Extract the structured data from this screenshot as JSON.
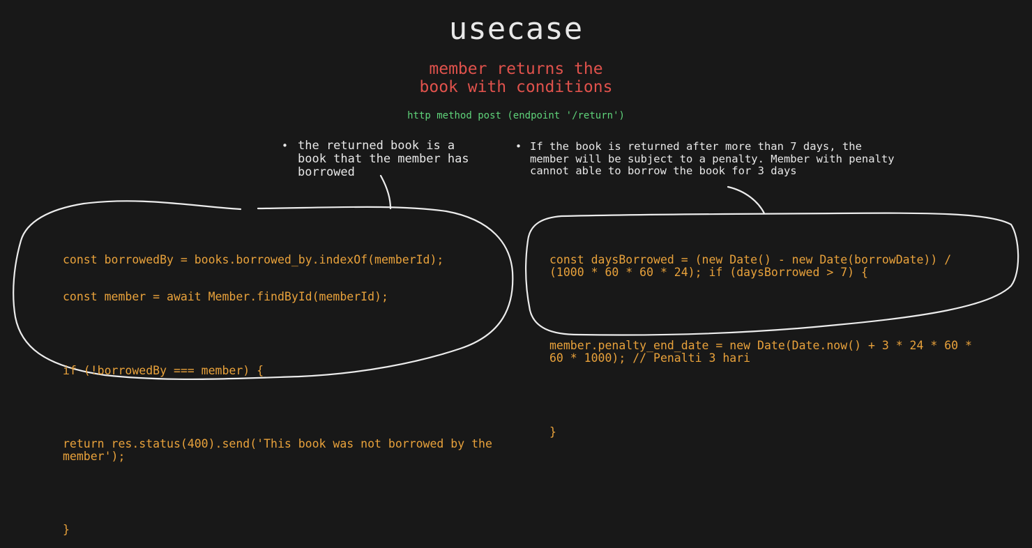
{
  "colors": {
    "background": "#181818",
    "text": "#e8e8e8",
    "heading_red": "#e0524c",
    "endpoint_green": "#5fd37a",
    "code_orange": "#e9a23b",
    "outline": "#ececec"
  },
  "title": "usecase",
  "subtitle": "member returns the\nbook with conditions",
  "endpoint": "http method post (endpoint '/return')",
  "notes": {
    "left": {
      "bullet": "•",
      "text": "the returned book is a\nbook that the member has\nborrowed"
    },
    "right": {
      "bullet": "•",
      "text": "If the book is returned after more than 7 days, the\nmember will be subject to a penalty. Member with penalty\ncannot able to borrow the book for 3 days"
    }
  },
  "code_blocks": {
    "left": {
      "line1": "const borrowedBy = books.borrowed_by.indexOf(memberId);",
      "line2": "const member = await Member.findById(memberId);",
      "line3": "if (!borrowedBy === member) {",
      "line4": "return res.status(400).send('This book was not borrowed by the member');",
      "line5": "}"
    },
    "right": {
      "line1": "const daysBorrowed = (new Date() - new Date(borrowDate)) / (1000 * 60 * 60 * 24); if (daysBorrowed > 7) {",
      "line2": "member.penalty_end_date = new Date(Date.now() + 3 * 24 * 60 * 60 * 1000); // Penalti 3 hari",
      "line3": "}"
    }
  }
}
